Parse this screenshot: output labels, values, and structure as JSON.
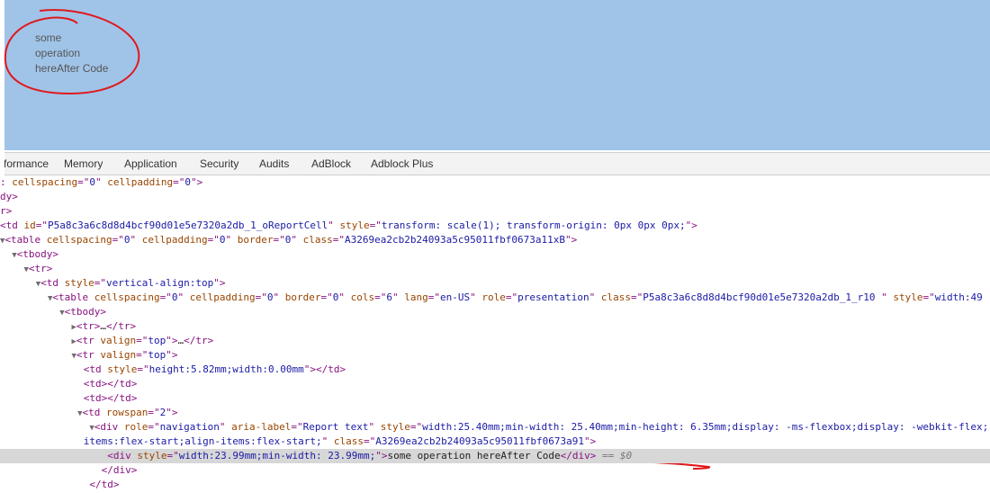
{
  "viewport": {
    "lines": [
      "some",
      "operation",
      "hereAfter Code"
    ],
    "bg": "#a0c4e8",
    "annotation_color": "#e0191e"
  },
  "tabs": [
    "rformance",
    "Memory",
    "Application",
    "Security",
    "Audits",
    "AdBlock",
    "Adblock Plus"
  ],
  "dom": {
    "l1_a": "cellspacing",
    "l1_b": "0",
    "l1_c": "cellpadding",
    "l1_d": "0",
    "l2": "dy>",
    "l3": "r>",
    "l4_id": "P5a8c3a6c8d8d4bcf90d01e5e7320a2db_1_oReportCell",
    "l4_style": "transform: scale(1); transform-origin: 0px 0px 0px;",
    "l5_class": "A3269ea2cb2b24093a5c95011fbf0673a11xB",
    "l8_style": "vertical-align:top",
    "l9_cols": "6",
    "l9_lang": "en-US",
    "l9_role": "presentation",
    "l9_class": "P5a8c3a6c8d8d4bcf90d01e5e7320a2db_1_r10 ",
    "l9_style": "width:49",
    "valign": "top",
    "l13_style": "height:5.82mm;width:0.00mm",
    "rowspan": "2",
    "l17_style": "width:25.40mm;min-width: 25.40mm;min-height: 6.35mm;display: -ms-flexbox;display: -webkit-flex;",
    "l17_role": "navigation",
    "l17_aria": "Report text",
    "l18_pre": "items:flex-start;align-items:flex-start;",
    "l18_class": "A3269ea2cb2b24093a5c95011fbf0673a91",
    "l19_style": "width:23.99mm;min-width: 23.99mm;",
    "l19_text": "some operation hereAfter Code",
    "l19_dollar": "== $0",
    "ellipsis": "…"
  }
}
